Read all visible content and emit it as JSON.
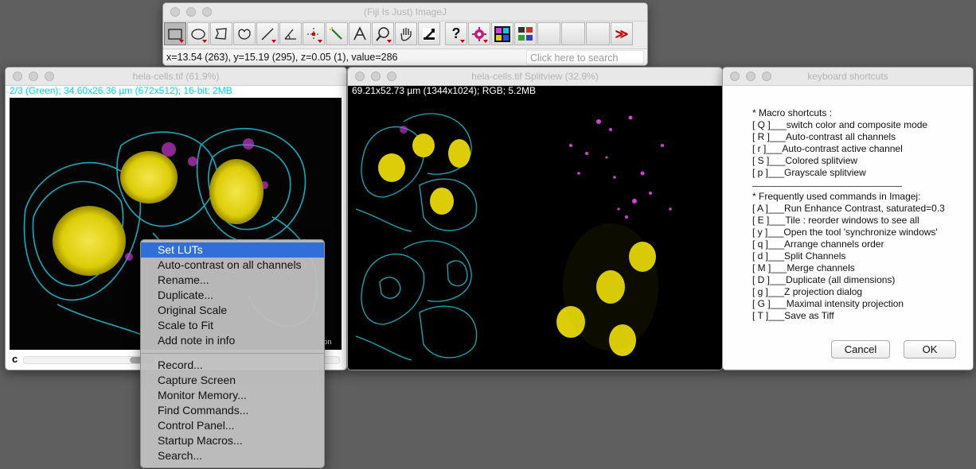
{
  "imagej_window": {
    "title": "(Fiji Is Just) ImageJ",
    "tools": [
      {
        "icon": "rectangle-select-icon",
        "selected": true
      },
      {
        "icon": "oval-select-icon"
      },
      {
        "icon": "polygon-select-icon"
      },
      {
        "icon": "freehand-select-icon"
      },
      {
        "icon": "line-tool-icon"
      },
      {
        "icon": "angle-tool-icon"
      },
      {
        "icon": "point-tool-icon"
      },
      {
        "icon": "wand-tool-icon"
      },
      {
        "icon": "text-tool-icon"
      },
      {
        "icon": "magnifier-icon"
      },
      {
        "icon": "hand-tool-icon"
      },
      {
        "icon": "dropper-icon"
      },
      {
        "icon": "help-question-icon",
        "label": "?"
      },
      {
        "icon": "developer-menu-icon"
      },
      {
        "icon": "lut-menu-icon"
      },
      {
        "icon": "stacks-menu-icon"
      },
      {
        "icon": "empty-slot-icon"
      },
      {
        "icon": "empty-slot-icon"
      },
      {
        "icon": "empty-slot-icon"
      },
      {
        "icon": "more-tools-icon",
        "label": "≫"
      }
    ],
    "status": "x=13.54 (263), y=15.19 (295), z=0.05 (1), value=286",
    "search_placeholder": "Click here to search"
  },
  "image_window_1": {
    "title": "hela-cells.tif (61.9%)",
    "subtitle": "2/3 (Green); 34.60x26.36 µm (672x512); 16-bit; 2MB",
    "channel_label": "c",
    "corner_text": "tion"
  },
  "image_window_2": {
    "title": "hela-cells.tif Splitview (32.9%)",
    "subtitle": "69.21x52.73 µm (1344x1024); RGB; 5.2MB"
  },
  "shortcuts_window": {
    "title": "keyboard shortcuts",
    "lines_macro": [
      "* Macro shortcuts :",
      "[ Q ]___switch color and composite mode",
      "[ R ]___Auto-contrast all channels",
      "[ r ]___Auto-contrast active channel",
      "[ S ]___Colored splitview",
      "[ p ]___Grayscale splitview"
    ],
    "lines_commands": [
      "* Frequently used commands in Imagej:",
      "[ A ]___Run Enhance Contrast, saturated=0.3",
      "[ E ]___Tile : reorder windows to see all",
      "[ y ]___Open the tool 'synchronize windows'",
      "[ q ]___Arrange channels order",
      "[ d ]___Split Channels",
      "[ M ]___Merge channels",
      "[ D ]___Duplicate (all dimensions)",
      "[ g ]___Z projection dialog",
      "[ G ]___Maximal intensity projection",
      "[ T ]___Save as Tiff"
    ],
    "cancel": "Cancel",
    "ok": "OK"
  },
  "context_menu": {
    "group1": [
      "Set LUTs",
      "Auto-contrast on all channels",
      "Rename...",
      "Duplicate...",
      "Original Scale",
      "Scale to Fit",
      "Add note in info"
    ],
    "group2": [
      "Record...",
      "Capture Screen",
      "Monitor Memory...",
      "Find Commands...",
      "Control Panel...",
      "Startup Macros...",
      "Search..."
    ],
    "highlighted": "Set LUTs"
  },
  "colors": {
    "cyan_channel": "#19d2e6",
    "yellow_nucleus": "#e8d80a",
    "magenta_channel": "#e040e6",
    "menu_highlight": "#2f6fd7"
  }
}
